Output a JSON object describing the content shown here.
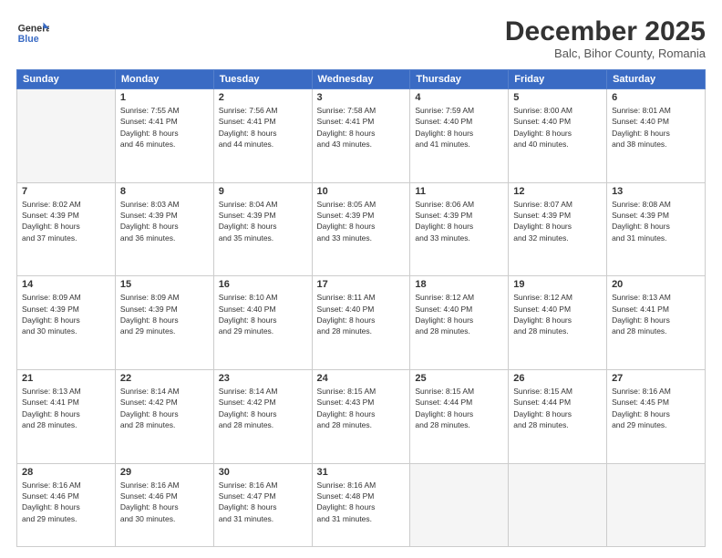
{
  "header": {
    "logo_line1": "General",
    "logo_line2": "Blue",
    "month": "December 2025",
    "location": "Balc, Bihor County, Romania"
  },
  "weekdays": [
    "Sunday",
    "Monday",
    "Tuesday",
    "Wednesday",
    "Thursday",
    "Friday",
    "Saturday"
  ],
  "weeks": [
    [
      {
        "day": "",
        "info": ""
      },
      {
        "day": "1",
        "info": "Sunrise: 7:55 AM\nSunset: 4:41 PM\nDaylight: 8 hours\nand 46 minutes."
      },
      {
        "day": "2",
        "info": "Sunrise: 7:56 AM\nSunset: 4:41 PM\nDaylight: 8 hours\nand 44 minutes."
      },
      {
        "day": "3",
        "info": "Sunrise: 7:58 AM\nSunset: 4:41 PM\nDaylight: 8 hours\nand 43 minutes."
      },
      {
        "day": "4",
        "info": "Sunrise: 7:59 AM\nSunset: 4:40 PM\nDaylight: 8 hours\nand 41 minutes."
      },
      {
        "day": "5",
        "info": "Sunrise: 8:00 AM\nSunset: 4:40 PM\nDaylight: 8 hours\nand 40 minutes."
      },
      {
        "day": "6",
        "info": "Sunrise: 8:01 AM\nSunset: 4:40 PM\nDaylight: 8 hours\nand 38 minutes."
      }
    ],
    [
      {
        "day": "7",
        "info": "Sunrise: 8:02 AM\nSunset: 4:39 PM\nDaylight: 8 hours\nand 37 minutes."
      },
      {
        "day": "8",
        "info": "Sunrise: 8:03 AM\nSunset: 4:39 PM\nDaylight: 8 hours\nand 36 minutes."
      },
      {
        "day": "9",
        "info": "Sunrise: 8:04 AM\nSunset: 4:39 PM\nDaylight: 8 hours\nand 35 minutes."
      },
      {
        "day": "10",
        "info": "Sunrise: 8:05 AM\nSunset: 4:39 PM\nDaylight: 8 hours\nand 33 minutes."
      },
      {
        "day": "11",
        "info": "Sunrise: 8:06 AM\nSunset: 4:39 PM\nDaylight: 8 hours\nand 33 minutes."
      },
      {
        "day": "12",
        "info": "Sunrise: 8:07 AM\nSunset: 4:39 PM\nDaylight: 8 hours\nand 32 minutes."
      },
      {
        "day": "13",
        "info": "Sunrise: 8:08 AM\nSunset: 4:39 PM\nDaylight: 8 hours\nand 31 minutes."
      }
    ],
    [
      {
        "day": "14",
        "info": "Sunrise: 8:09 AM\nSunset: 4:39 PM\nDaylight: 8 hours\nand 30 minutes."
      },
      {
        "day": "15",
        "info": "Sunrise: 8:09 AM\nSunset: 4:39 PM\nDaylight: 8 hours\nand 29 minutes."
      },
      {
        "day": "16",
        "info": "Sunrise: 8:10 AM\nSunset: 4:40 PM\nDaylight: 8 hours\nand 29 minutes."
      },
      {
        "day": "17",
        "info": "Sunrise: 8:11 AM\nSunset: 4:40 PM\nDaylight: 8 hours\nand 28 minutes."
      },
      {
        "day": "18",
        "info": "Sunrise: 8:12 AM\nSunset: 4:40 PM\nDaylight: 8 hours\nand 28 minutes."
      },
      {
        "day": "19",
        "info": "Sunrise: 8:12 AM\nSunset: 4:40 PM\nDaylight: 8 hours\nand 28 minutes."
      },
      {
        "day": "20",
        "info": "Sunrise: 8:13 AM\nSunset: 4:41 PM\nDaylight: 8 hours\nand 28 minutes."
      }
    ],
    [
      {
        "day": "21",
        "info": "Sunrise: 8:13 AM\nSunset: 4:41 PM\nDaylight: 8 hours\nand 28 minutes."
      },
      {
        "day": "22",
        "info": "Sunrise: 8:14 AM\nSunset: 4:42 PM\nDaylight: 8 hours\nand 28 minutes."
      },
      {
        "day": "23",
        "info": "Sunrise: 8:14 AM\nSunset: 4:42 PM\nDaylight: 8 hours\nand 28 minutes."
      },
      {
        "day": "24",
        "info": "Sunrise: 8:15 AM\nSunset: 4:43 PM\nDaylight: 8 hours\nand 28 minutes."
      },
      {
        "day": "25",
        "info": "Sunrise: 8:15 AM\nSunset: 4:44 PM\nDaylight: 8 hours\nand 28 minutes."
      },
      {
        "day": "26",
        "info": "Sunrise: 8:15 AM\nSunset: 4:44 PM\nDaylight: 8 hours\nand 28 minutes."
      },
      {
        "day": "27",
        "info": "Sunrise: 8:16 AM\nSunset: 4:45 PM\nDaylight: 8 hours\nand 29 minutes."
      }
    ],
    [
      {
        "day": "28",
        "info": "Sunrise: 8:16 AM\nSunset: 4:46 PM\nDaylight: 8 hours\nand 29 minutes."
      },
      {
        "day": "29",
        "info": "Sunrise: 8:16 AM\nSunset: 4:46 PM\nDaylight: 8 hours\nand 30 minutes."
      },
      {
        "day": "30",
        "info": "Sunrise: 8:16 AM\nSunset: 4:47 PM\nDaylight: 8 hours\nand 31 minutes."
      },
      {
        "day": "31",
        "info": "Sunrise: 8:16 AM\nSunset: 4:48 PM\nDaylight: 8 hours\nand 31 minutes."
      },
      {
        "day": "",
        "info": ""
      },
      {
        "day": "",
        "info": ""
      },
      {
        "day": "",
        "info": ""
      }
    ]
  ]
}
